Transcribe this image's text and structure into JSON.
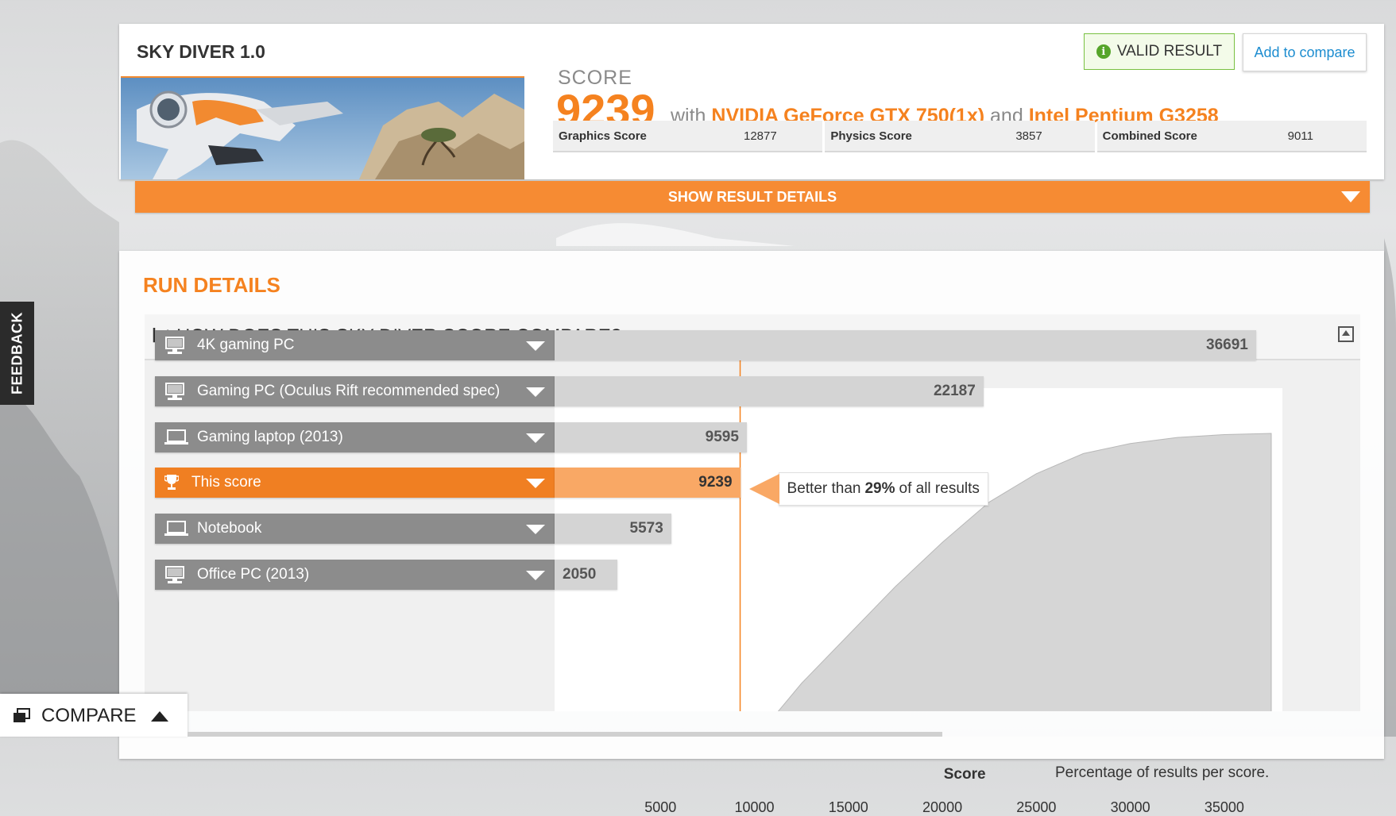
{
  "benchmark": {
    "title": "SKY DIVER 1.0"
  },
  "result": {
    "score_label": "SCORE",
    "score": "9239",
    "with_text": "with",
    "gpu": "NVIDIA GeForce GTX 750(1x)",
    "and_text": "and",
    "cpu": "Intel Pentium G3258",
    "valid_label": "VALID RESULT",
    "valid_icon": "info-icon",
    "compare_label": "Add to compare",
    "subscores": [
      {
        "name": "Graphics Score",
        "value": "12877"
      },
      {
        "name": "Physics Score",
        "value": "3857"
      },
      {
        "name": "Combined Score",
        "value": "9011"
      }
    ],
    "details_label": "SHOW RESULT DETAILS"
  },
  "run_details": {
    "title": "RUN DETAILS",
    "compare_title": "HOW DOES THIS SKY DIVER SCORE COMPARE?",
    "callout": {
      "prefix": "Better than",
      "percent": "29%",
      "suffix": "of all results"
    },
    "axis_title": "Score",
    "note": "Percentage of results per score."
  },
  "chart_data": {
    "type": "bar",
    "orientation": "horizontal",
    "categories": [
      "4K gaming PC",
      "Gaming PC (Oculus Rift recommended spec)",
      "Gaming laptop (2013)",
      "This score",
      "Notebook",
      "Office PC (2013)"
    ],
    "values": [
      36691,
      22187,
      9595,
      9239,
      5573,
      2050
    ],
    "icons": [
      "desktop-icon",
      "desktop-icon",
      "laptop-icon",
      "trophy-icon",
      "laptop-icon",
      "desktop-icon"
    ],
    "highlight_index": 3,
    "xlabel": "Score",
    "xlim": [
      0,
      37500
    ],
    "xticks": [
      5000,
      10000,
      15000,
      20000,
      25000,
      30000,
      35000
    ],
    "distribution": [
      [
        0,
        0
      ],
      [
        5000,
        4
      ],
      [
        7000,
        8
      ],
      [
        8000,
        12
      ],
      [
        10000,
        24
      ],
      [
        12500,
        38
      ],
      [
        15000,
        50
      ],
      [
        17500,
        62
      ],
      [
        20000,
        73
      ],
      [
        22500,
        83
      ],
      [
        25000,
        90
      ],
      [
        27500,
        95
      ],
      [
        30000,
        97.5
      ],
      [
        32500,
        99
      ],
      [
        35000,
        99.7
      ],
      [
        37500,
        100
      ]
    ],
    "marker_value": 9239,
    "colors": {
      "bar": "#d4d4d4",
      "highlight": "#f9a865",
      "label": "#8c8c8c",
      "label_highlight": "#f07f22",
      "distribution": "#d6d6d6",
      "marker": "#f5821f"
    }
  },
  "sidebar": {
    "feedback_label": "FEEDBACK"
  },
  "compare_bar": {
    "label": "COMPARE"
  },
  "colors": {
    "accent": "#f5821f",
    "valid": "#56a52a",
    "link": "#1d8dd0"
  }
}
